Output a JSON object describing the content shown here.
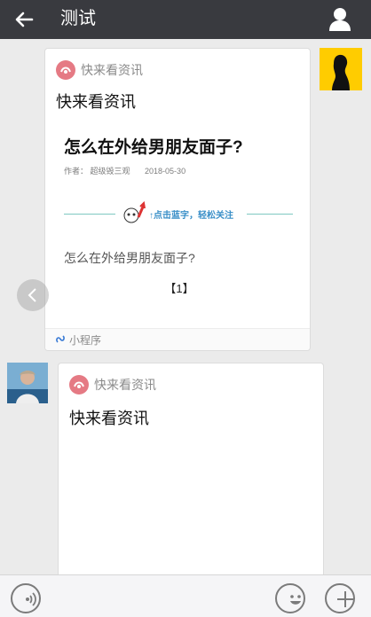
{
  "header": {
    "title": "测试",
    "back_icon": "arrow-left-icon",
    "user_icon": "user-icon"
  },
  "messages": [
    {
      "mp_name": "快来看资讯",
      "title": "快来看资讯",
      "preview": {
        "article_title": "怎么在外给男朋友面子?",
        "author": "作者：  超级毁三观",
        "date": "2018-05-30",
        "banner_text": "↑点击蓝字，轻松关注",
        "subtitle": "怎么在外给男朋友面子?",
        "page_number": "【1】"
      },
      "footer_label": "小程序"
    },
    {
      "mp_name": "快来看资讯",
      "title": "快来看资讯"
    }
  ],
  "bottom": {
    "voice_icon": "voice-icon",
    "emoji_icon": "emoji-icon",
    "plus_icon": "plus-icon"
  }
}
